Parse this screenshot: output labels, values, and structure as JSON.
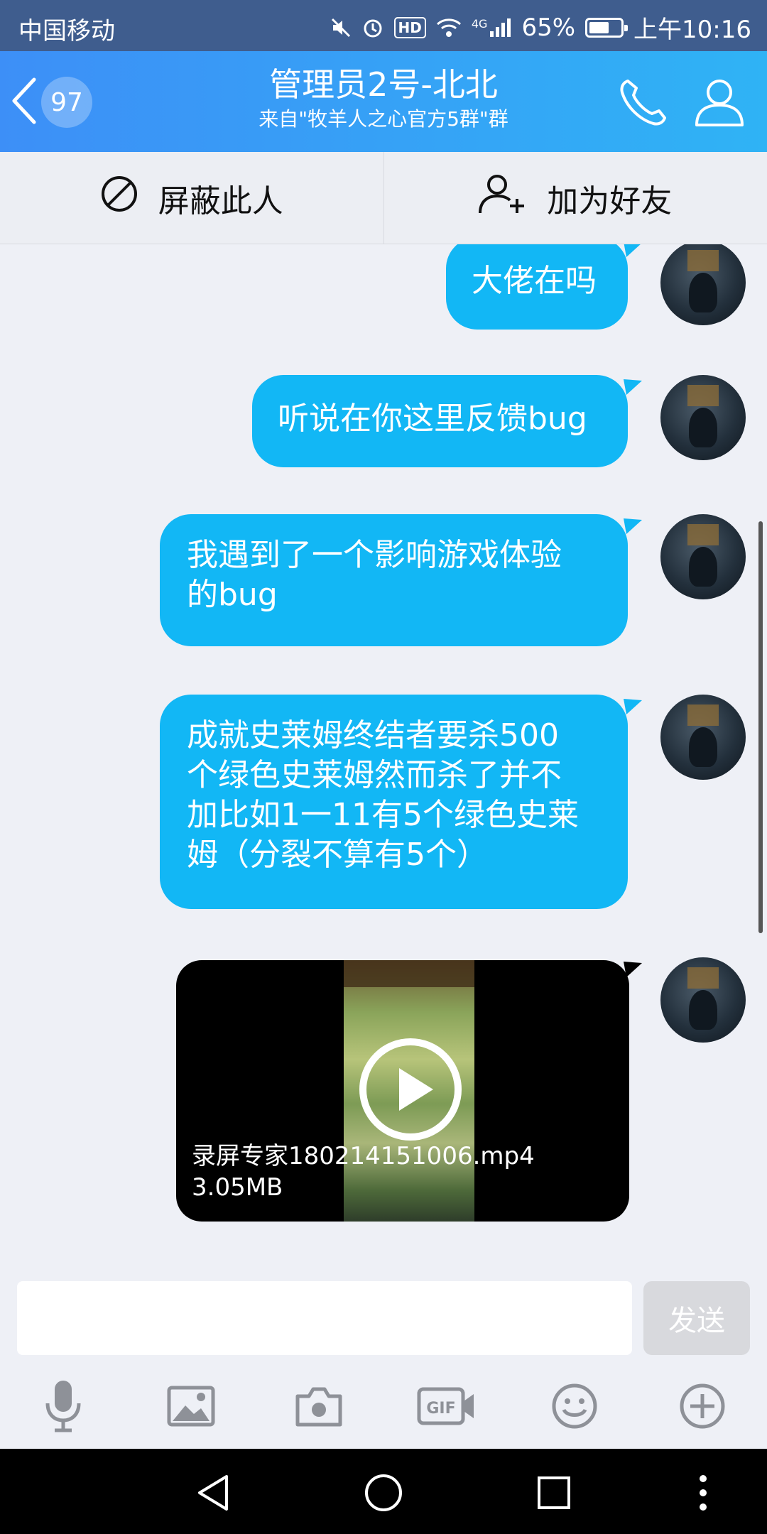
{
  "status_bar": {
    "carrier": "中国移动",
    "network": "4G",
    "battery": "65%",
    "battery_level": 0.65,
    "time": "上午10:16",
    "icons": [
      "mute-icon",
      "alarm-icon",
      "hd-icon",
      "wifi-icon",
      "signal-icon",
      "battery-icon"
    ]
  },
  "header": {
    "back_count": "97",
    "title": "管理员2号-北北",
    "subtitle": "来自\"牧羊人之心官方5群\"群",
    "accent": "#2fb3f5"
  },
  "actions": {
    "block_label": "屏蔽此人",
    "add_friend_label": "加为好友"
  },
  "messages": [
    {
      "text": "大佬在吗"
    },
    {
      "text": "听说在你这里反馈bug"
    },
    {
      "text": "我遇到了一个影响游戏体验\n的bug"
    },
    {
      "text": "成就史莱姆终结者要杀500\n个绿色史莱姆然而杀了并不\n加比如1一11有5个绿色史莱\n姆（分裂不算有5个）"
    }
  ],
  "video_message": {
    "file_name": "录屏专家180214151006.mp4",
    "file_size": "3.05MB"
  },
  "input": {
    "value": "",
    "send_label": "发送"
  },
  "toolbar_icons": [
    "microphone-icon",
    "image-icon",
    "camera-icon",
    "gif-icon",
    "emoji-icon",
    "plus-icon"
  ],
  "colors": {
    "bubble": "#12b7f5",
    "status_bar": "#3f5d8e",
    "chat_background": "#eef0f6"
  }
}
